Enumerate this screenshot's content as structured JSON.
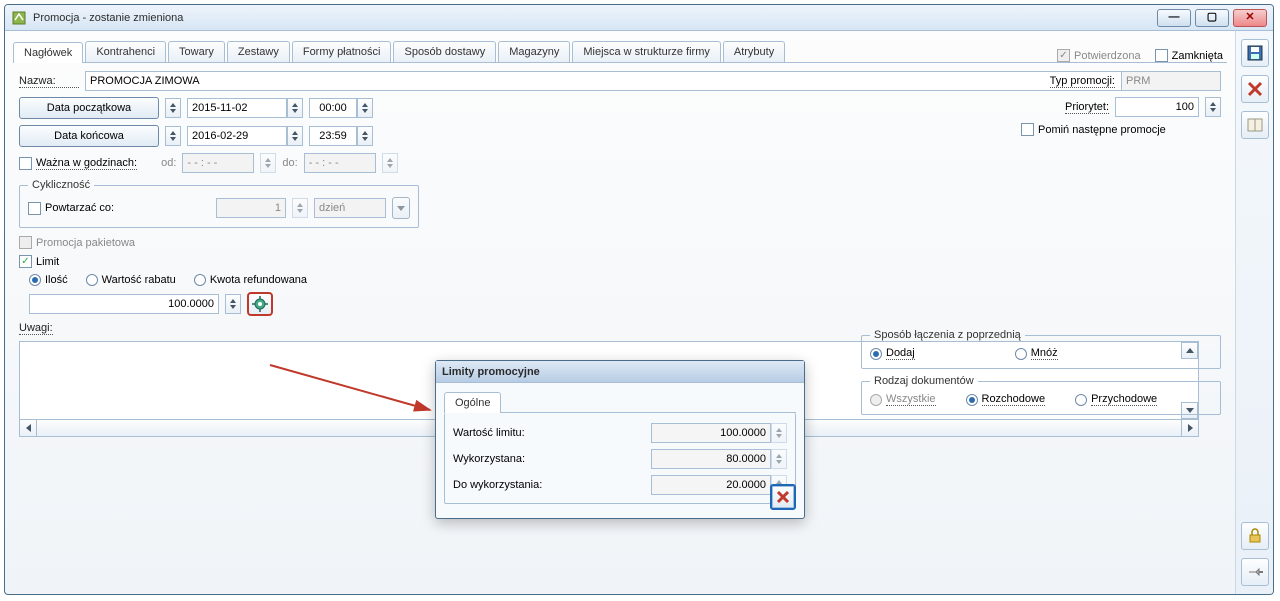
{
  "window": {
    "title": "Promocja - zostanie zmieniona",
    "min": "—",
    "max": "▢",
    "close": "✕"
  },
  "tabs": {
    "items": [
      "Nagłówek",
      "Kontrahenci",
      "Towary",
      "Zestawy",
      "Formy płatności",
      "Sposób dostawy",
      "Magazyny",
      "Miejsca w strukturze firmy",
      "Atrybuty"
    ],
    "confirmed_label": "Potwierdzona",
    "closed_label": "Zamknięta"
  },
  "form": {
    "name_label": "Nazwa:",
    "name_value": "PROMOCJA ZIMOWA",
    "start_btn": "Data początkowa",
    "end_btn": "Data końcowa",
    "start_date": "2015-11-02",
    "start_time": "00:00",
    "end_date": "2016-02-29",
    "end_time": "23:59",
    "hours_label": "Ważna w godzinach:",
    "hours_from_label": "od:",
    "hours_from": "- - : - -",
    "hours_to_label": "do:",
    "hours_to": "- - : - -",
    "cyclic_legend": "Cykliczność",
    "repeat_label": "Powtarzać co:",
    "repeat_value": "1",
    "repeat_unit": "dzień",
    "package_label": "Promocja pakietowa",
    "limit_label": "Limit",
    "limit_radio": {
      "qty": "Ilość",
      "discount": "Wartość rabatu",
      "refund": "Kwota refundowana"
    },
    "limit_value": "100.0000",
    "notes_label": "Uwagi:"
  },
  "right": {
    "type_label": "Typ promocji:",
    "type_value": "PRM",
    "priority_label": "Priorytet:",
    "priority_value": "100",
    "skip_label": "Pomiń następne promocje",
    "combine_legend": "Sposób łączenia z poprzednią",
    "combine_add": "Dodaj",
    "combine_mul": "Mnóż",
    "doc_legend": "Rodzaj dokumentów",
    "doc_all": "Wszystkie",
    "doc_out": "Rozchodowe",
    "doc_in": "Przychodowe"
  },
  "dialog": {
    "title": "Limity promocyjne",
    "tab": "Ogólne",
    "limit_label": "Wartość limitu:",
    "limit_value": "100.0000",
    "used_label": "Wykorzystana:",
    "used_value": "80.0000",
    "avail_label": "Do wykorzystania:",
    "avail_value": "20.0000"
  },
  "icons": {
    "save": "save-icon",
    "delete": "delete-icon",
    "book": "book-icon",
    "lock": "lock-icon",
    "pin": "pin-icon",
    "gear": "gear-icon"
  }
}
